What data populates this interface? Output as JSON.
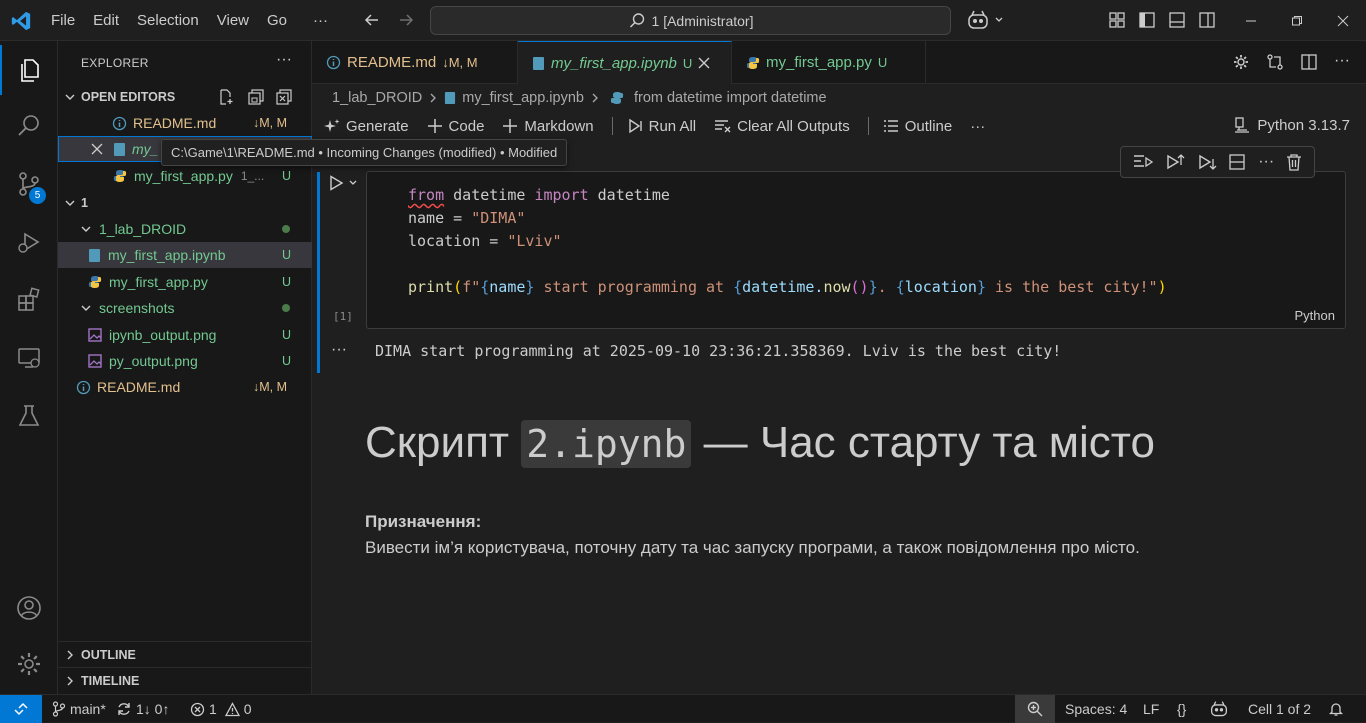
{
  "menu": [
    "File",
    "Edit",
    "Selection",
    "View",
    "Go",
    "···"
  ],
  "search": {
    "text": "1 [Administrator]"
  },
  "activity": {
    "scm_badge": "5"
  },
  "sidebar": {
    "title": "EXPLORER",
    "more": "···",
    "open_editors": {
      "header": "OPEN EDITORS",
      "items": [
        {
          "name": "README.md",
          "status": "↓M, M"
        },
        {
          "name": "my_",
          "status": ""
        },
        {
          "name": "my_first_app.py",
          "path": "1_...",
          "status": "U"
        }
      ]
    },
    "folder": {
      "name": "1",
      "items": [
        {
          "name": "1_lab_DROID"
        },
        {
          "name": "my_first_app.ipynb",
          "status": "U"
        },
        {
          "name": "my_first_app.py",
          "status": "U"
        },
        {
          "name": "screenshots"
        },
        {
          "name": "ipynb_output.png",
          "status": "U"
        },
        {
          "name": "py_output.png",
          "status": "U"
        },
        {
          "name": "README.md",
          "status": "↓M, M"
        }
      ]
    },
    "outline": "OUTLINE",
    "timeline": "TIMELINE"
  },
  "tooltip": "C:\\Game\\1\\README.md • Incoming Changes (modified) • Modified",
  "tabs": [
    {
      "name": "README.md",
      "status": "↓M, M"
    },
    {
      "name": "my_first_app.ipynb",
      "status": "U"
    },
    {
      "name": "my_first_app.py",
      "status": "U"
    }
  ],
  "breadcrumb": [
    "1_lab_DROID",
    "my_first_app.ipynb",
    "from datetime import datetime"
  ],
  "toolbar": {
    "generate": "Generate",
    "code": "Code",
    "markdown": "Markdown",
    "run_all": "Run All",
    "clear": "Clear All Outputs",
    "outline": "Outline",
    "more": "···",
    "kernel": "Python 3.13.7"
  },
  "cell": {
    "line1_from": "from",
    "line1_rest": " datetime ",
    "line1_import": "import",
    "line1_end": " datetime",
    "line2_var": "name",
    "line2_eq": " = ",
    "line2_str": "\"DIMA\"",
    "line3_var": "location",
    "line3_eq": " = ",
    "line3_str": "\"Lviv\"",
    "line5_print": "print",
    "line5_open": "(",
    "line5_f": "f\"",
    "line5_b1": "{",
    "line5_name": "name",
    "line5_b2": "}",
    "line5_mid1": " start programming at ",
    "line5_b3": "{",
    "line5_dt": "datetime.",
    "line5_now": "now",
    "line5_parens": "()",
    "line5_b4": "}",
    "line5_mid2": ". ",
    "line5_b5": "{",
    "line5_loc": "location",
    "line5_b6": "}",
    "line5_end": " is the best city!\"",
    "line5_close": ")",
    "language": "Python",
    "exec_count": "[1]",
    "output": "DIMA start programming at 2025-09-10 23:36:21.358369. Lviv is the best city!",
    "output_dots": "···"
  },
  "markdown": {
    "h1_a": "Скрипт ",
    "h1_code": "2.ipynb",
    "h1_b": " — Час старту та місто",
    "bold": "Призначення:",
    "para": "Вивести ім’я користувача, поточну дату та час запуску програми, а також повідомлення про місто."
  },
  "status": {
    "branch": "main*",
    "sync": "1↓ 0↑",
    "errors": "1",
    "warnings": "0",
    "spaces": "Spaces: 4",
    "eol": "LF",
    "braces": "{}",
    "cell": "Cell 1 of 2"
  },
  "colors": {
    "accent": "#0078d4",
    "untracked": "#73c991",
    "modified": "#e2c08d"
  }
}
